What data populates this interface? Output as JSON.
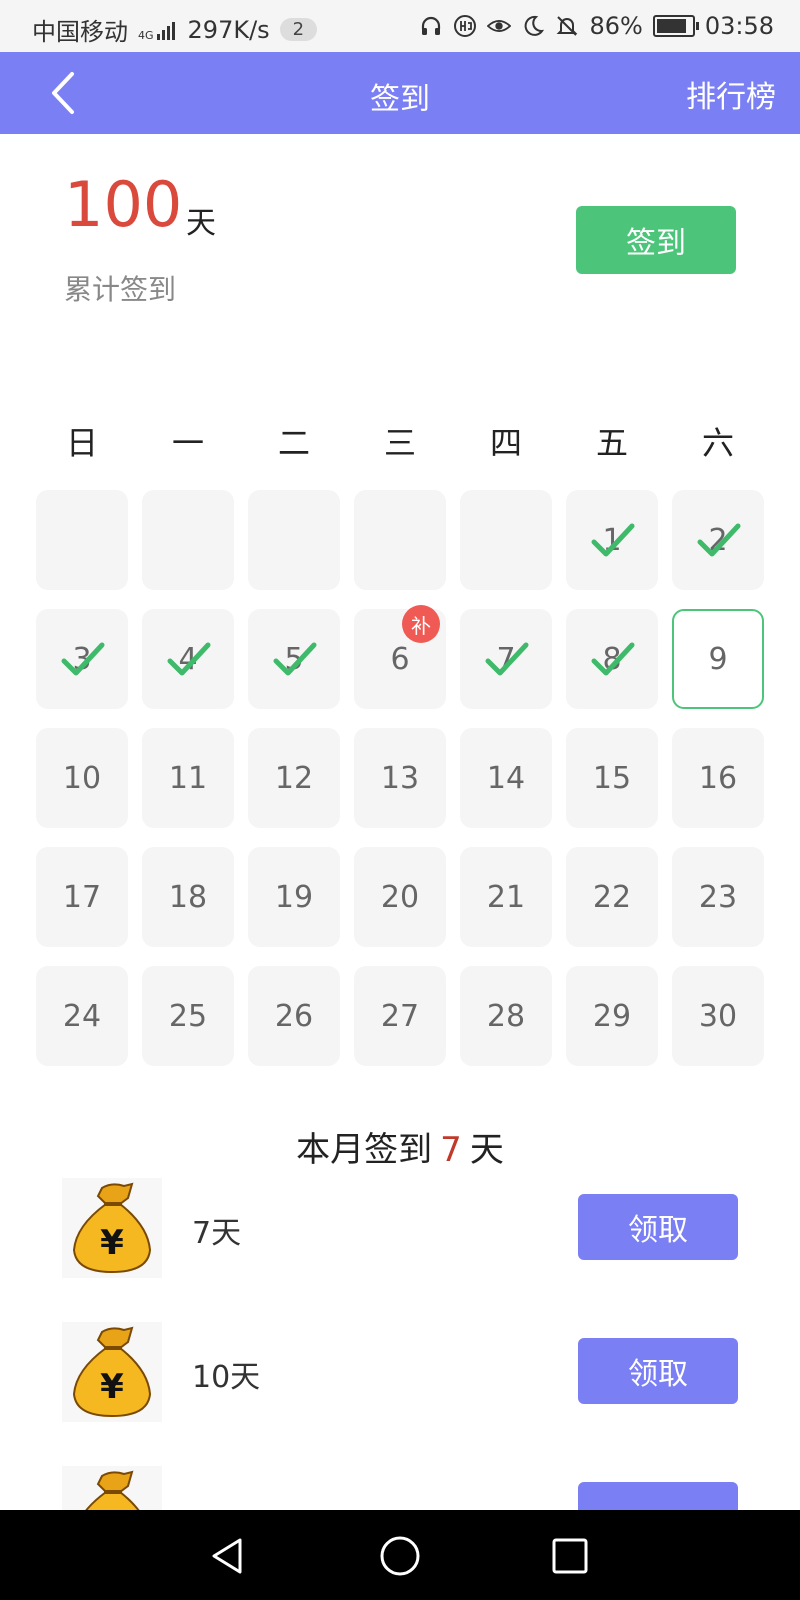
{
  "status_bar": {
    "carrier": "中国移动",
    "network": "4G",
    "speed": "297K/s",
    "notif_count": "2",
    "battery": "86%",
    "battery_level": 0.86,
    "time": "03:58"
  },
  "app_bar": {
    "title": "签到",
    "right_action": "排行榜"
  },
  "summary": {
    "total_days": "100",
    "unit": "天",
    "label": "累计签到",
    "signin_button": "签到"
  },
  "weekdays": [
    "日",
    "一",
    "二",
    "三",
    "四",
    "五",
    "六"
  ],
  "calendar": {
    "leading_blanks": 5,
    "days": [
      {
        "day": "1",
        "state": "checked"
      },
      {
        "day": "2",
        "state": "checked"
      },
      {
        "day": "3",
        "state": "checked"
      },
      {
        "day": "4",
        "state": "checked"
      },
      {
        "day": "5",
        "state": "checked"
      },
      {
        "day": "6",
        "state": "makeup",
        "badge": "补"
      },
      {
        "day": "7",
        "state": "checked"
      },
      {
        "day": "8",
        "state": "checked"
      },
      {
        "day": "9",
        "state": "today"
      },
      {
        "day": "10"
      },
      {
        "day": "11"
      },
      {
        "day": "12"
      },
      {
        "day": "13"
      },
      {
        "day": "14"
      },
      {
        "day": "15"
      },
      {
        "day": "16"
      },
      {
        "day": "17"
      },
      {
        "day": "18"
      },
      {
        "day": "19"
      },
      {
        "day": "20"
      },
      {
        "day": "21"
      },
      {
        "day": "22"
      },
      {
        "day": "23"
      },
      {
        "day": "24"
      },
      {
        "day": "25"
      },
      {
        "day": "26"
      },
      {
        "day": "27"
      },
      {
        "day": "28"
      },
      {
        "day": "29"
      },
      {
        "day": "30"
      }
    ]
  },
  "month_summary": {
    "prefix": "本月签到",
    "count": "7",
    "suffix": "天"
  },
  "rewards": [
    {
      "label": "7天",
      "button": "领取",
      "icon": "money-bag-icon"
    },
    {
      "label": "10天",
      "button": "领取",
      "icon": "money-bag-icon"
    }
  ],
  "colors": {
    "accent": "#7b7ff4",
    "signin_green": "#4cc57a",
    "highlight_red": "#d94a3c"
  }
}
